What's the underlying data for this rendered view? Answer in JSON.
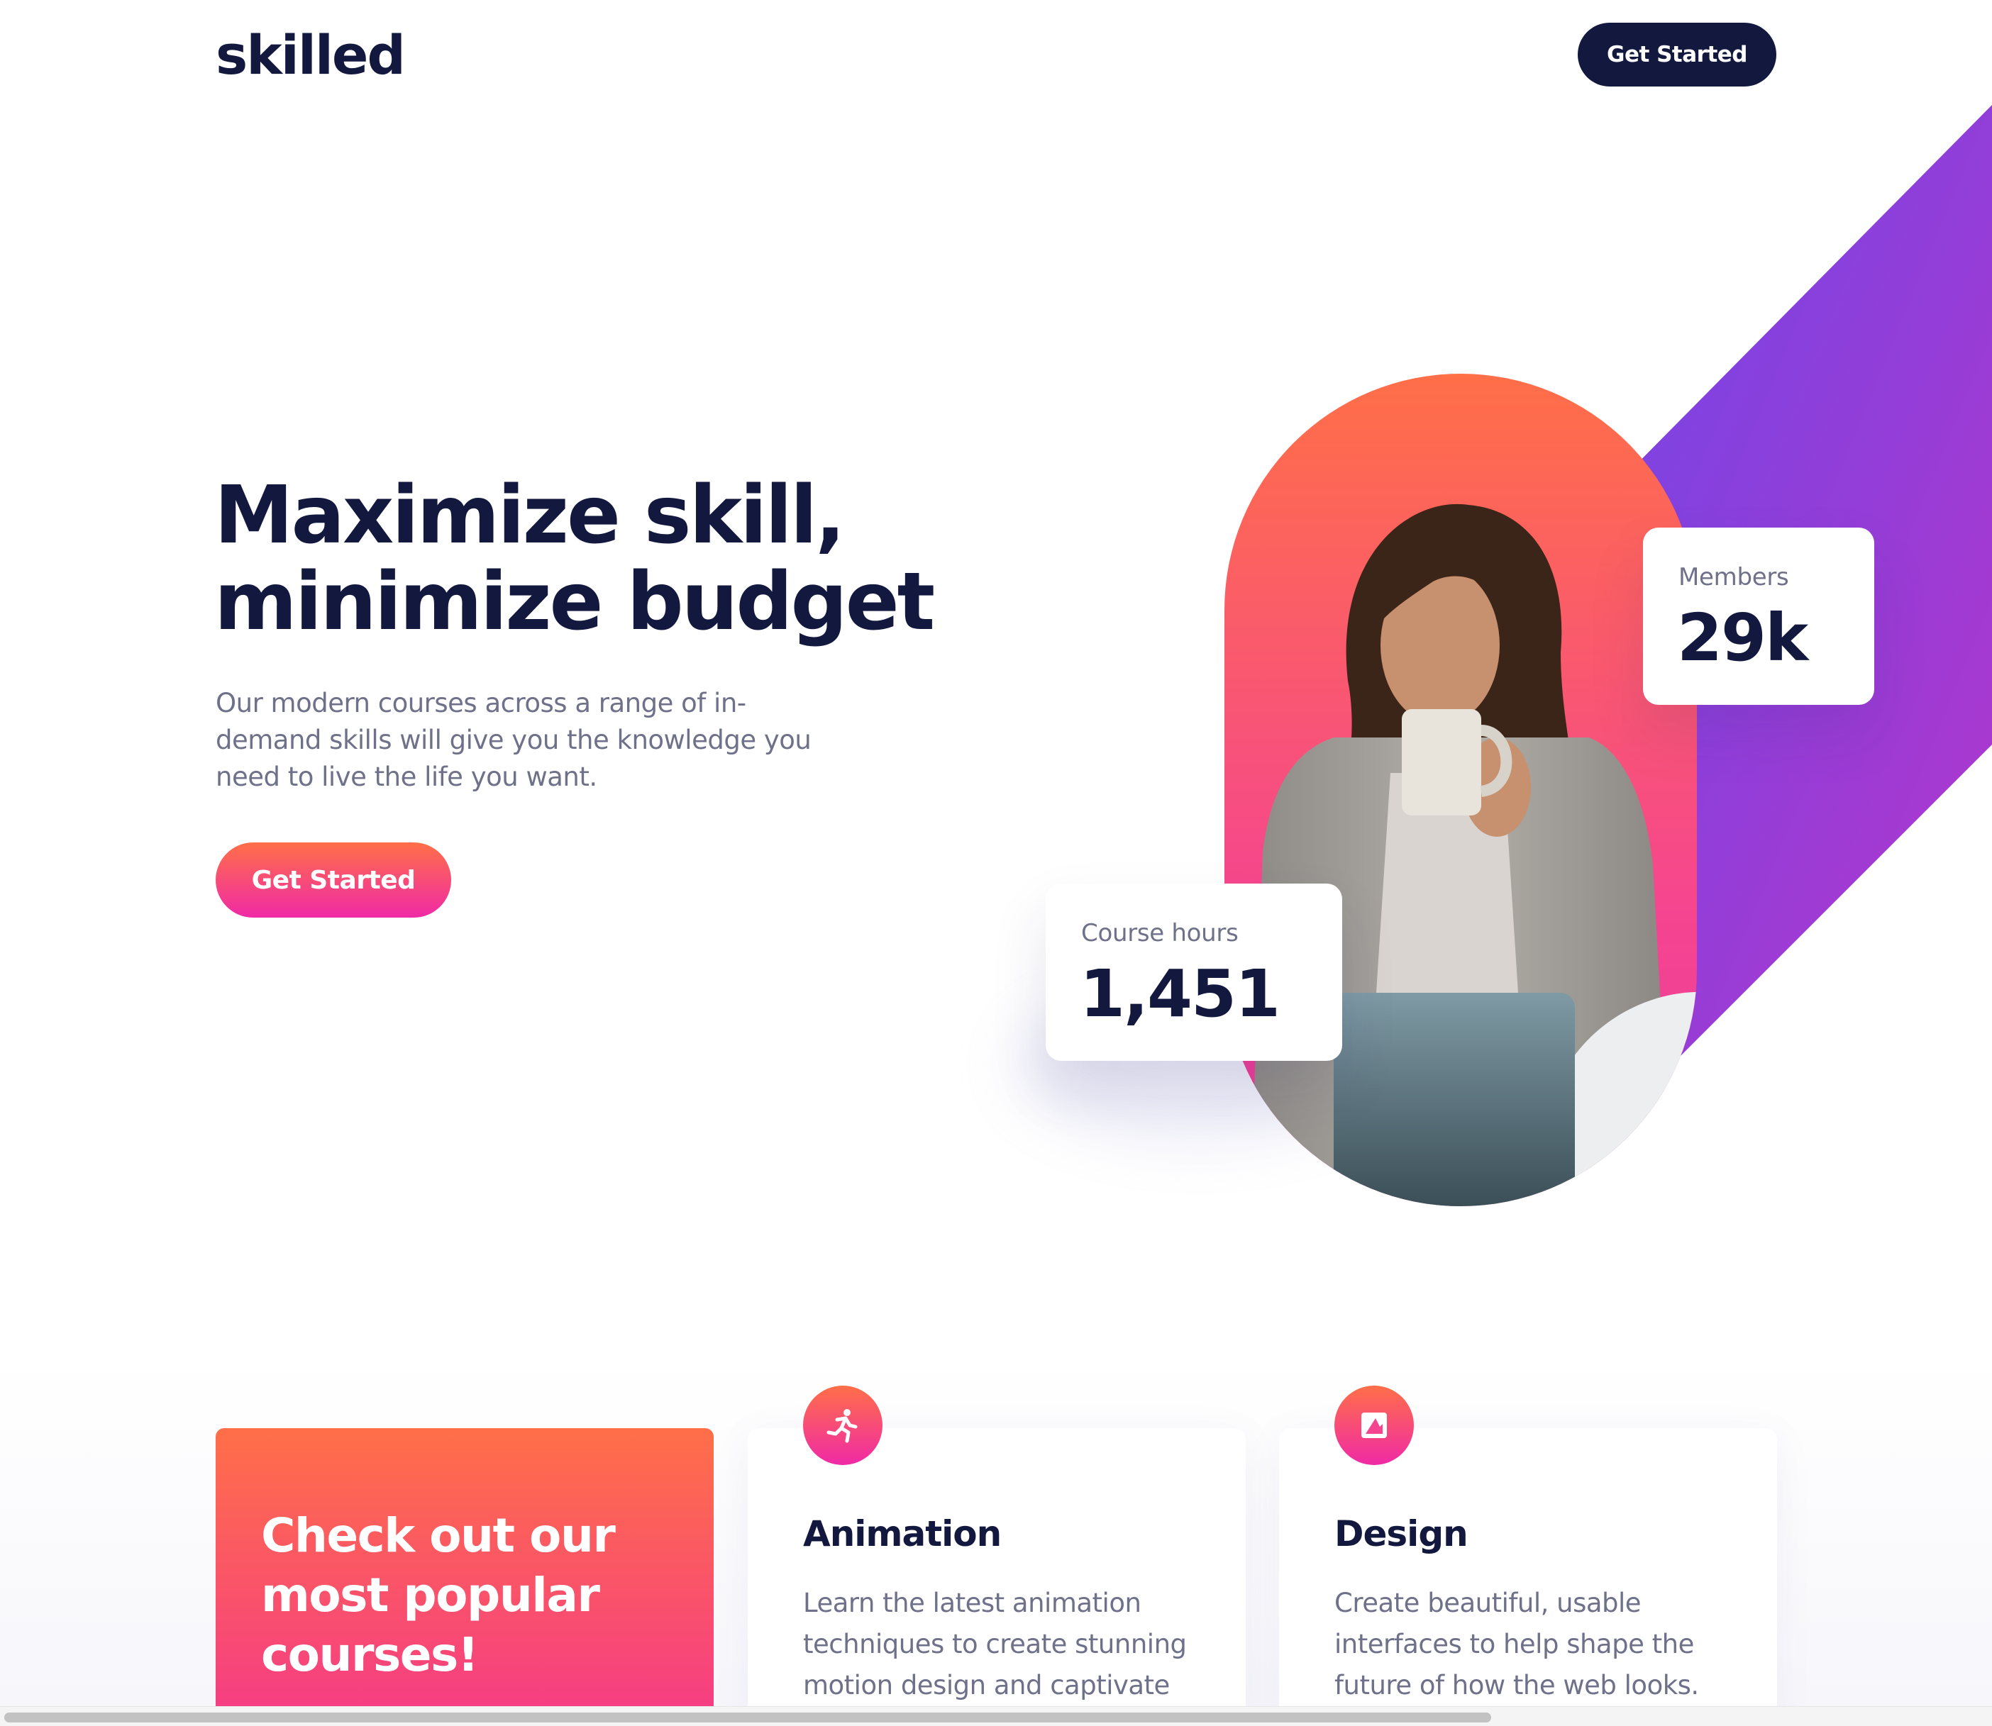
{
  "header": {
    "logo": "skilled",
    "cta_label": "Get Started"
  },
  "hero": {
    "title_line1": "Maximize skill,",
    "title_line2": "minimize budget",
    "description": "Our modern courses across a range of in-demand skills will give you the knowledge you need to live the life you want.",
    "cta_label": "Get Started",
    "stats": [
      {
        "label": "Members",
        "value": "29k"
      },
      {
        "label": "Course hours",
        "value": "1,451"
      }
    ]
  },
  "courses": {
    "promo_text": "Check out our most popular courses!",
    "items": [
      {
        "icon": "running-figure-icon",
        "title": "Animation",
        "description": "Learn the latest animation techniques to create stunning motion design and captivate"
      },
      {
        "icon": "design-square-icon",
        "title": "Design",
        "description": "Create beautiful, usable interfaces to help shape the future of how the web looks."
      }
    ]
  },
  "colors": {
    "navy": "#13183f",
    "orange": "#ff6f48",
    "pink": "#f02aa6",
    "purple": "#6c47e9",
    "muted_text": "#6e7189"
  }
}
